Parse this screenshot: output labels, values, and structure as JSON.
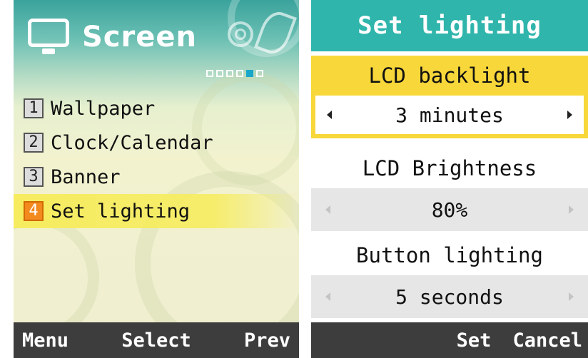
{
  "left": {
    "header": {
      "title": "Screen",
      "icon": "monitor-icon"
    },
    "page_indicator": {
      "total": 6,
      "current": 5
    },
    "menu_items": [
      {
        "number": "1",
        "label": "Wallpaper"
      },
      {
        "number": "2",
        "label": "Clock/Calendar"
      },
      {
        "number": "3",
        "label": "Banner"
      },
      {
        "number": "4",
        "label": "Set lighting",
        "selected": true
      }
    ],
    "softkeys": {
      "left": "Menu",
      "center": "Select",
      "right": "Prev"
    }
  },
  "right": {
    "title": "Set lighting",
    "settings": [
      {
        "label": "LCD backlight",
        "value": "3 minutes",
        "focused": true
      },
      {
        "label": "LCD Brightness",
        "value": "80%"
      },
      {
        "label": "Button lighting",
        "value": "5 seconds"
      }
    ],
    "softkeys": {
      "center": "Set",
      "right": "Cancel"
    }
  },
  "colors": {
    "title_bar": "#2fb5ac",
    "highlight_yellow": "#f7d73a",
    "selected_badge": "#f28a1e",
    "active_dot": "#1aa6c9",
    "softkey_bar": "#3d3d3d"
  }
}
